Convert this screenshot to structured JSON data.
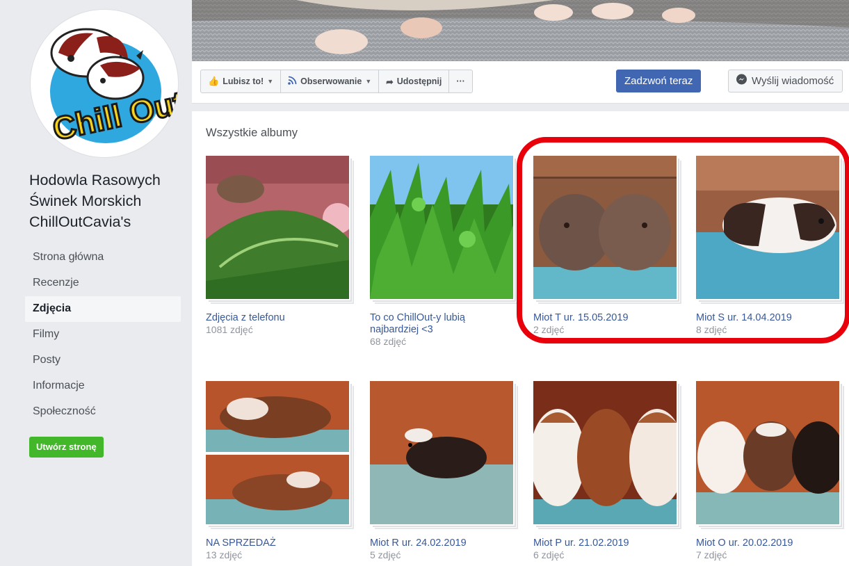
{
  "page": {
    "name_lines": [
      "Hodowla Rasowych",
      "Świnek Morskich",
      "ChillOutCavia's"
    ],
    "logo_text": "Chill Out"
  },
  "nav": [
    {
      "label": "Strona główna",
      "active": false
    },
    {
      "label": "Recenzje",
      "active": false
    },
    {
      "label": "Zdjęcia",
      "active": true
    },
    {
      "label": "Filmy",
      "active": false
    },
    {
      "label": "Posty",
      "active": false
    },
    {
      "label": "Informacje",
      "active": false
    },
    {
      "label": "Społeczność",
      "active": false
    }
  ],
  "create_page_label": "Utwórz stronę",
  "actions": {
    "like": "Lubisz to!",
    "follow": "Obserwowanie",
    "share": "Udostępnij",
    "more": "···",
    "call": "Zadzwoń teraz",
    "message": "Wyślij wiadomość"
  },
  "albums_title": "Wszystkie albumy",
  "albums": [
    {
      "title": "Zdjęcia z telefonu",
      "count": "1081 zdjęć"
    },
    {
      "title": "To co ChillOut-y lubią najbardziej <3",
      "count": "68 zdjęć"
    },
    {
      "title": "Miot T ur. 15.05.2019",
      "count": "2 zdjęć"
    },
    {
      "title": "Miot S ur. 14.04.2019",
      "count": "8 zdjęć"
    },
    {
      "title": "NA SPRZEDAŻ",
      "count": "13 zdjęć"
    },
    {
      "title": "Miot R ur. 24.02.2019",
      "count": "5 zdjęć"
    },
    {
      "title": "Miot P ur. 21.02.2019",
      "count": "6 zdjęć"
    },
    {
      "title": "Miot O ur. 20.02.2019",
      "count": "7 zdjęć"
    }
  ],
  "colors": {
    "brand_blue": "#4267b2",
    "link_blue": "#365899",
    "green": "#42b72a",
    "highlight_red": "#e8000b"
  }
}
